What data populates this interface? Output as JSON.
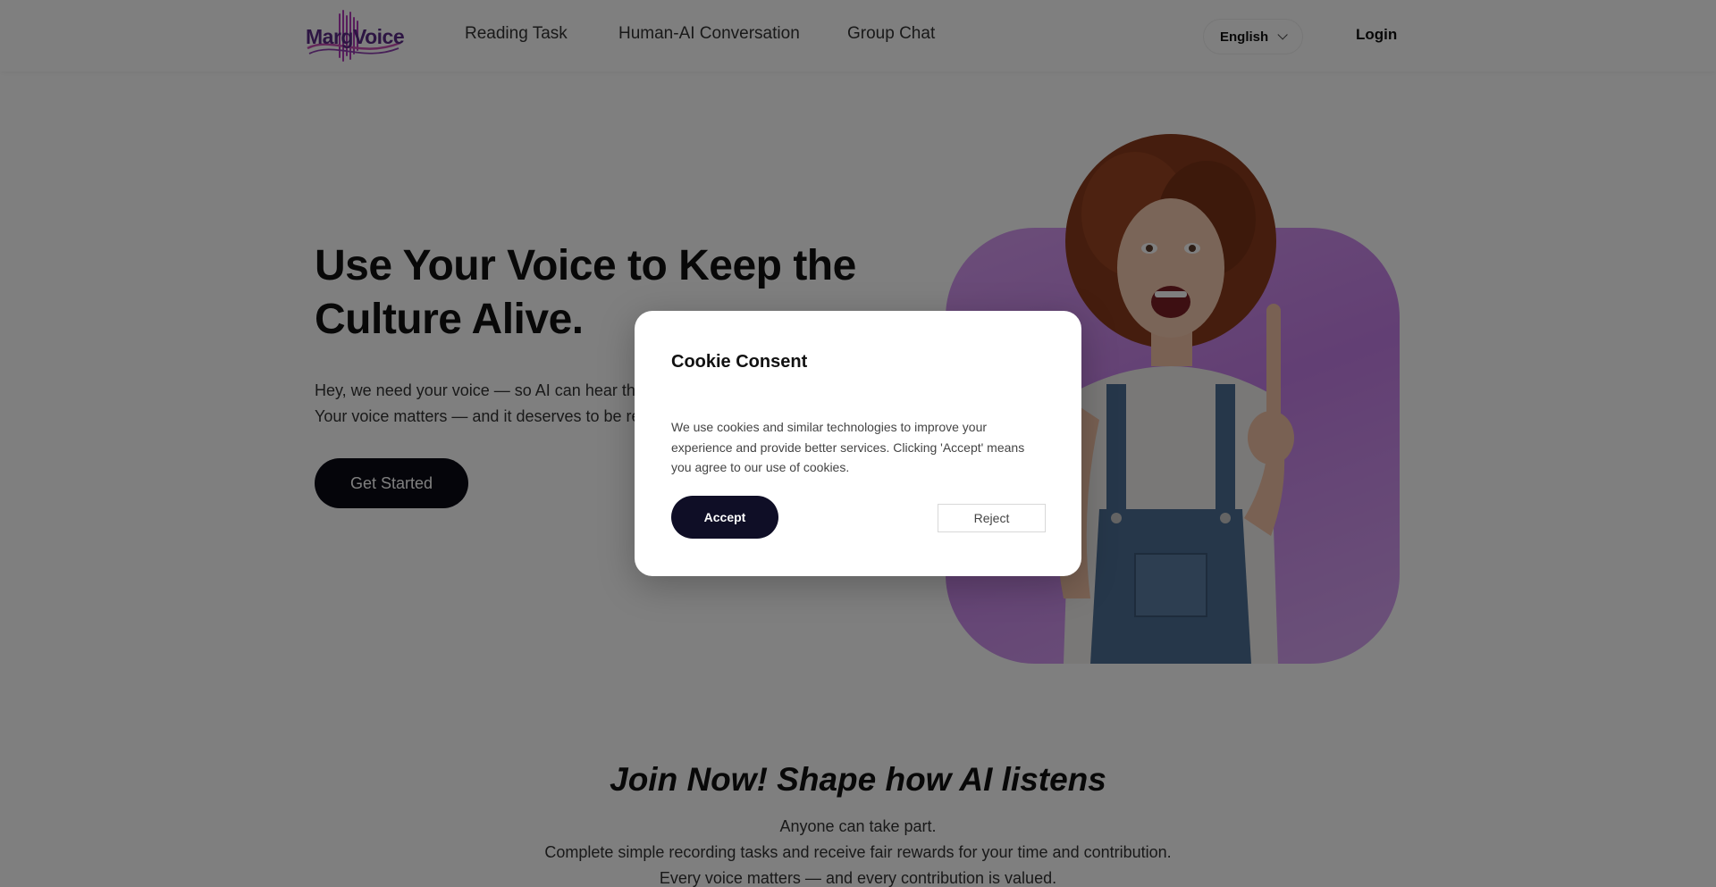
{
  "header": {
    "logo_text": "MargVoice",
    "nav": [
      "Reading Task",
      "Human-AI Conversation",
      "Group Chat"
    ],
    "language": "English",
    "login": "Login"
  },
  "hero": {
    "title_line1": "Use Your Voice to Keep the",
    "title_line2": "Culture Alive.",
    "sub_line1": "Hey, we need your voice — so AI can hear th",
    "sub_line2": "Your voice matters — and it deserves to be re",
    "cta": "Get Started"
  },
  "join": {
    "title": "Join Now! Shape how AI listens",
    "line1": "Anyone can take part.",
    "line2": "Complete simple recording tasks and receive fair rewards for your time and contribution.",
    "line3": "Every voice matters — and every contribution is valued."
  },
  "cookie": {
    "title": "Cookie Consent",
    "text": "We use cookies and similar technologies to improve your experience and provide better services. Clicking 'Accept' means you agree to our use of cookies.",
    "accept": "Accept",
    "reject": "Reject"
  },
  "colors": {
    "brand": "#5b2a86",
    "accent_purple": "#c57ee8",
    "button_dark": "#0b0b14"
  }
}
